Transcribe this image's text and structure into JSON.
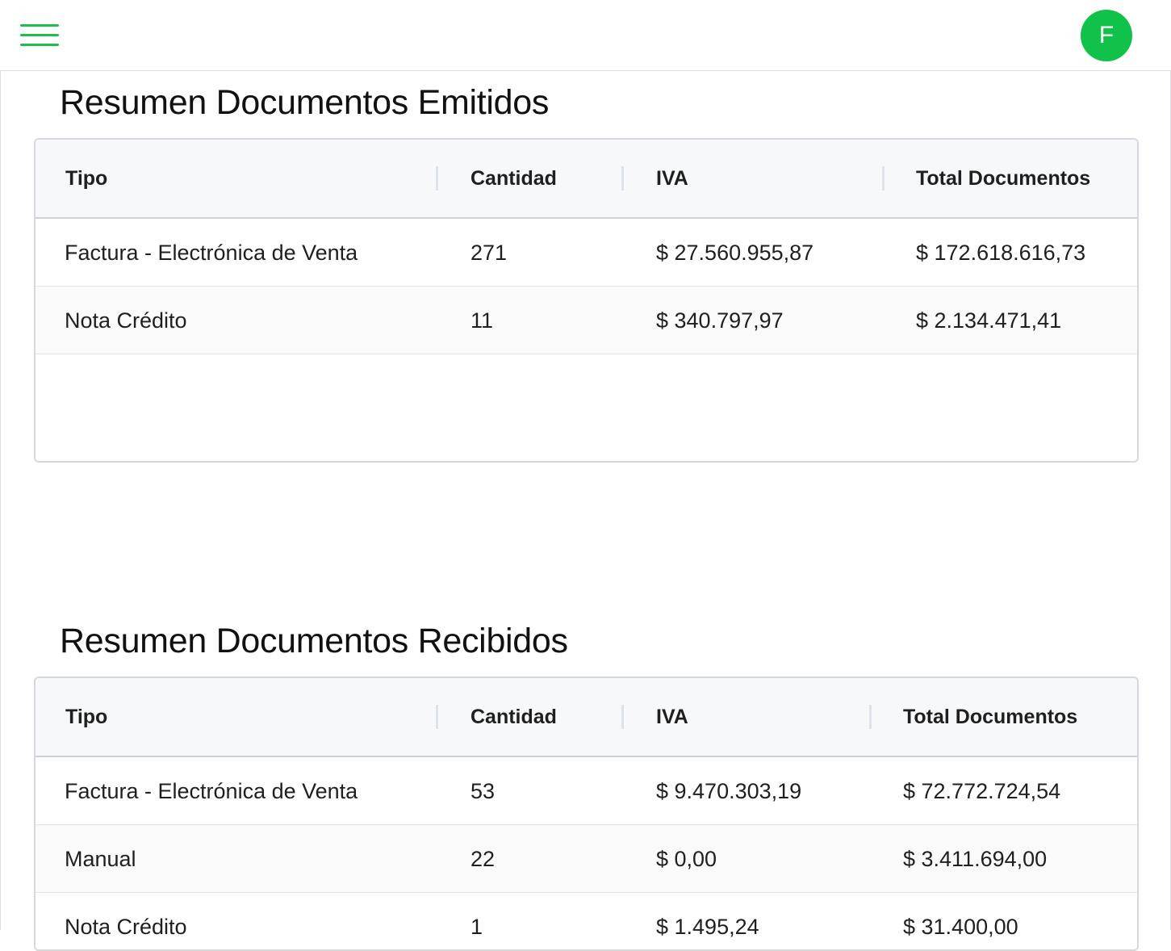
{
  "header": {
    "avatar_initial": "F",
    "accent_color": "#10c24a"
  },
  "emitidos": {
    "title": "Resumen Documentos Emitidos",
    "columns": [
      "Tipo",
      "Cantidad",
      "IVA",
      "Total Documentos"
    ],
    "rows": [
      [
        "Factura - Electrónica de Venta",
        "271",
        "$ 27.560.955,87",
        "$ 172.618.616,73"
      ],
      [
        "Nota Crédito",
        "11",
        "$ 340.797,97",
        "$ 2.134.471,41"
      ]
    ]
  },
  "recibidos": {
    "title": "Resumen Documentos Recibidos",
    "columns": [
      "Tipo",
      "Cantidad",
      "IVA",
      "Total Documentos"
    ],
    "rows": [
      [
        "Factura - Electrónica de Venta",
        "53",
        "$ 9.470.303,19",
        "$ 72.772.724,54"
      ],
      [
        "Manual",
        "22",
        "$ 0,00",
        "$ 3.411.694,00"
      ],
      [
        "Nota Crédito",
        "1",
        "$ 1.495,24",
        "$ 31.400,00"
      ]
    ]
  }
}
